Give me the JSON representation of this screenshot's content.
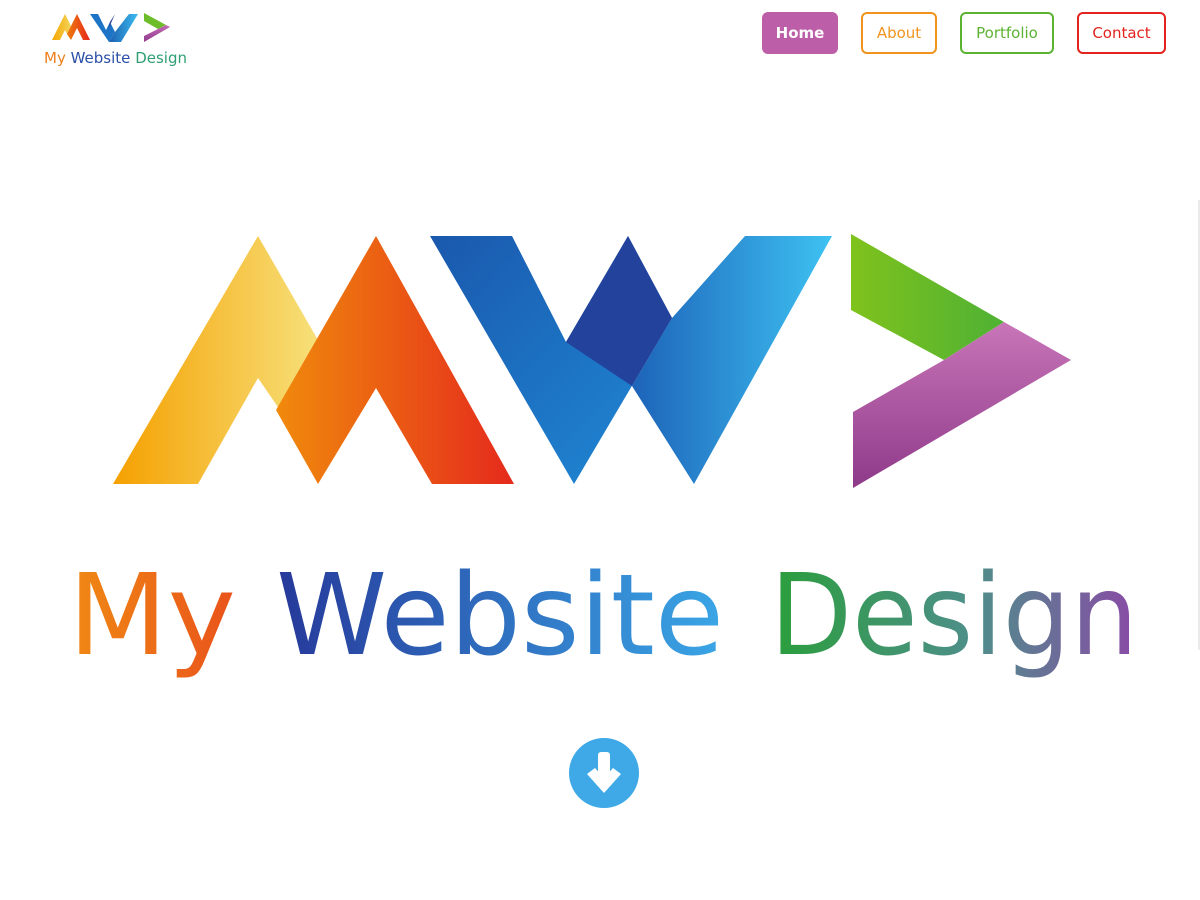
{
  "brand": {
    "name_parts": [
      "My",
      "Website",
      "Design"
    ],
    "logo_letters": "MW>"
  },
  "nav": {
    "items": [
      {
        "label": "Home",
        "active": true,
        "color": "#bd5fa8"
      },
      {
        "label": "About",
        "active": false,
        "color": "#f0941e"
      },
      {
        "label": "Portfolio",
        "active": false,
        "color": "#5bb332"
      },
      {
        "label": "Contact",
        "active": false,
        "color": "#e3231d"
      }
    ]
  },
  "hero": {
    "wordmark_parts": [
      "My",
      "Website",
      "Design"
    ]
  },
  "icons": {
    "scroll": "arrow-down-circle-icon"
  },
  "colors": {
    "orange": "#f0941e",
    "red_orange": "#e8501b",
    "blue": "#1e6fbf",
    "light_blue": "#3fa9e8",
    "green": "#5bb332",
    "purple": "#bd5fa8"
  }
}
